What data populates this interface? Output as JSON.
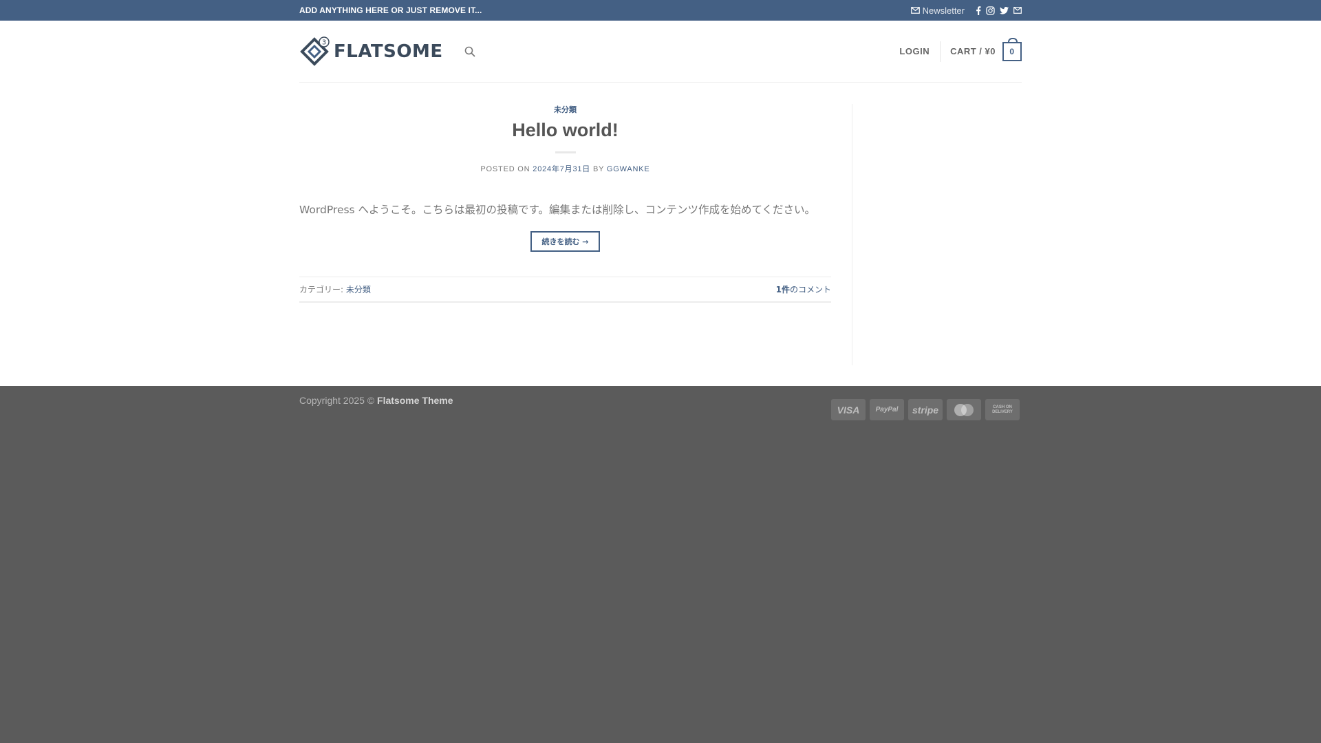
{
  "topbar": {
    "notice": "ADD ANYTHING HERE OR JUST REMOVE IT...",
    "newsletter_label": "Newsletter",
    "social_icons": [
      "facebook-icon",
      "instagram-icon",
      "twitter-icon",
      "email-icon"
    ]
  },
  "header": {
    "logo_text": "FLATSOME",
    "logo_badge": "3",
    "login_label": "LOGIN",
    "cart_label": "CART / ¥0",
    "cart_count": "0"
  },
  "post": {
    "category": "未分類",
    "title": "Hello world!",
    "meta_posted_on": "POSTED ON",
    "meta_date": "2024年7月31日",
    "meta_by": "BY",
    "meta_author": "GGWANKE",
    "excerpt": "WordPress へようこそ。こちらは最初の投稿です。編集または削除し、コンテンツ作成を始めてください。",
    "read_more_label": "続きを読む →",
    "footer_category_label": "カテゴリー:",
    "footer_category_link": "未分類",
    "comment_count": "1件",
    "comment_suffix": "のコメント"
  },
  "footer": {
    "copyright_prefix": "Copyright 2025 ©",
    "copyright_brand": "Flatsome Theme",
    "payments": {
      "visa": "VISA",
      "paypal": "PayPal",
      "stripe": "stripe",
      "cod": "CASH ON DELIVERY"
    }
  },
  "colors": {
    "primary": "#446084",
    "footer_bg": "#5b5b5b",
    "page_bg": "#ffffff"
  }
}
